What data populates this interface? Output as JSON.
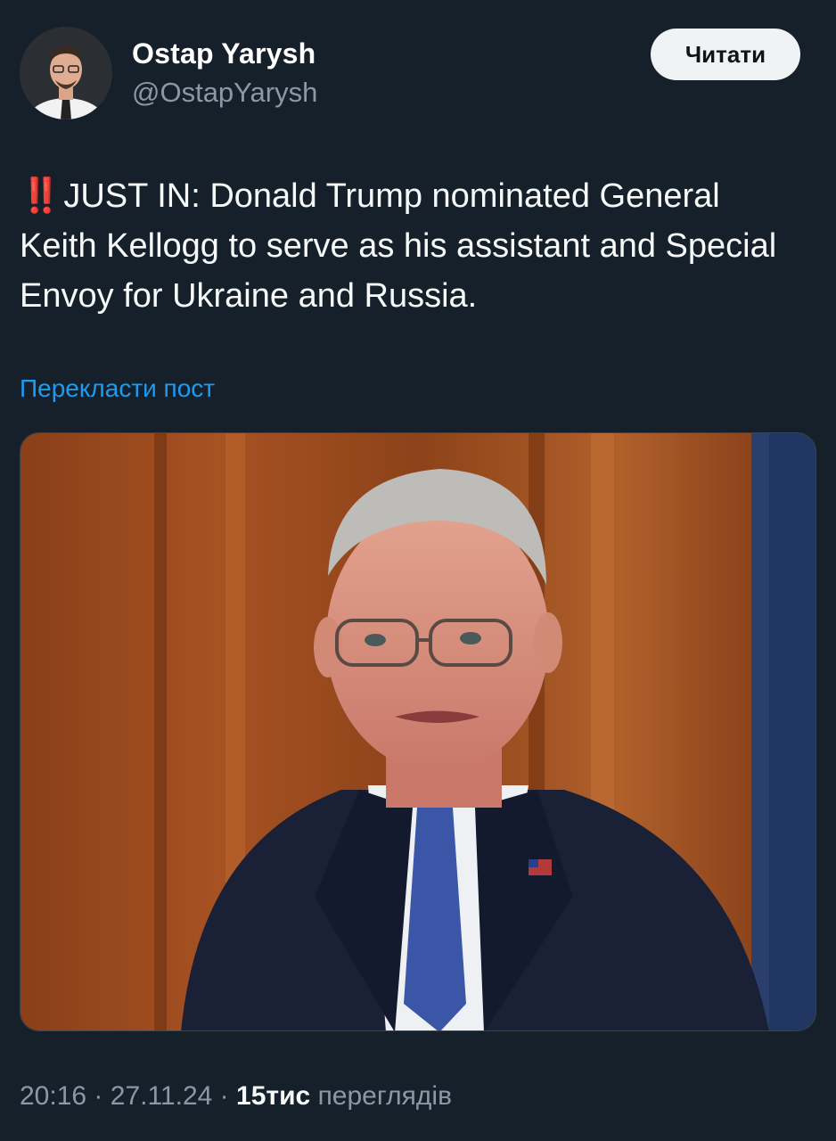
{
  "author": {
    "name": "Ostap Yarysh",
    "handle": "@OstapYarysh"
  },
  "follow_button": {
    "label": "Читати"
  },
  "post": {
    "emoji": "‼️",
    "text": "JUST IN: Donald Trump nominated General Keith Kellogg to serve as his assistant and Special Envoy for Ukraine and Russia."
  },
  "translate_link": {
    "label": "Перекласти пост"
  },
  "meta": {
    "time": "20:16",
    "separator": "·",
    "date": "27.11.24",
    "views_count": "15тис",
    "views_label": "переглядів"
  },
  "colors": {
    "background": "#15202b",
    "link": "#1d9bf0",
    "muted": "#8b98a5",
    "button_bg": "#eff3f4"
  }
}
